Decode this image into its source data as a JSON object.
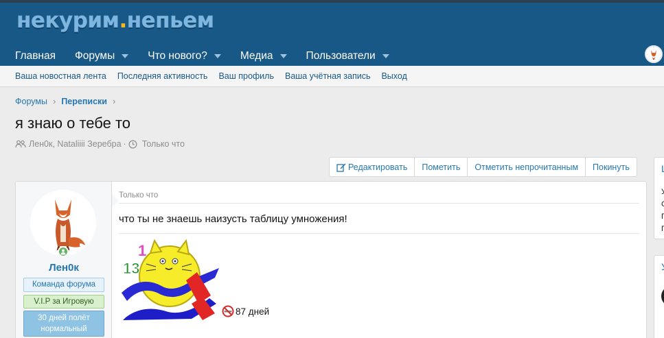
{
  "header": {
    "logo_main": "некурим",
    "logo_dot": ".",
    "logo_tail": "непьем",
    "nav": [
      {
        "label": "Главная",
        "has_caret": false
      },
      {
        "label": "Форумы",
        "has_caret": true
      },
      {
        "label": "Что нового?",
        "has_caret": true
      },
      {
        "label": "Медиа",
        "has_caret": true
      },
      {
        "label": "Пользователи",
        "has_caret": true
      }
    ]
  },
  "subnav": {
    "items": [
      "Ваша новостная лента",
      "Последняя активность",
      "Ваш профиль",
      "Ваша учётная запись",
      "Выход"
    ]
  },
  "breadcrumb": {
    "items": [
      "Форумы",
      "Переписки"
    ]
  },
  "thread": {
    "title": "я знаю о тебе то",
    "participants": "Лен0к, Nataliiii Зеребра",
    "meta_sep": "·",
    "time": "Только что"
  },
  "actions": [
    "Редактировать",
    "Пометить",
    "Отметить непрочитанным",
    "Покинуть"
  ],
  "message": {
    "username": "Лен0к",
    "badges": [
      "Команда форума",
      "V.I.P за Игровую",
      "30 дней полёт нормальный"
    ],
    "date": "Только что",
    "text": "что ты не знаешь наизусть таблицу умножения!",
    "signature_days": "87 дней",
    "signature_img_numbers": [
      "1",
      "13"
    ]
  },
  "sidebar": {
    "block1_title": "Ц",
    "block1_lines": [
      "У",
      "С",
      "П",
      "П"
    ],
    "block2_title": "У"
  },
  "colors": {
    "header_bg": "#185886",
    "link": "#2577b1",
    "online": "#63b265",
    "logo_dot": "#f5b81c"
  }
}
